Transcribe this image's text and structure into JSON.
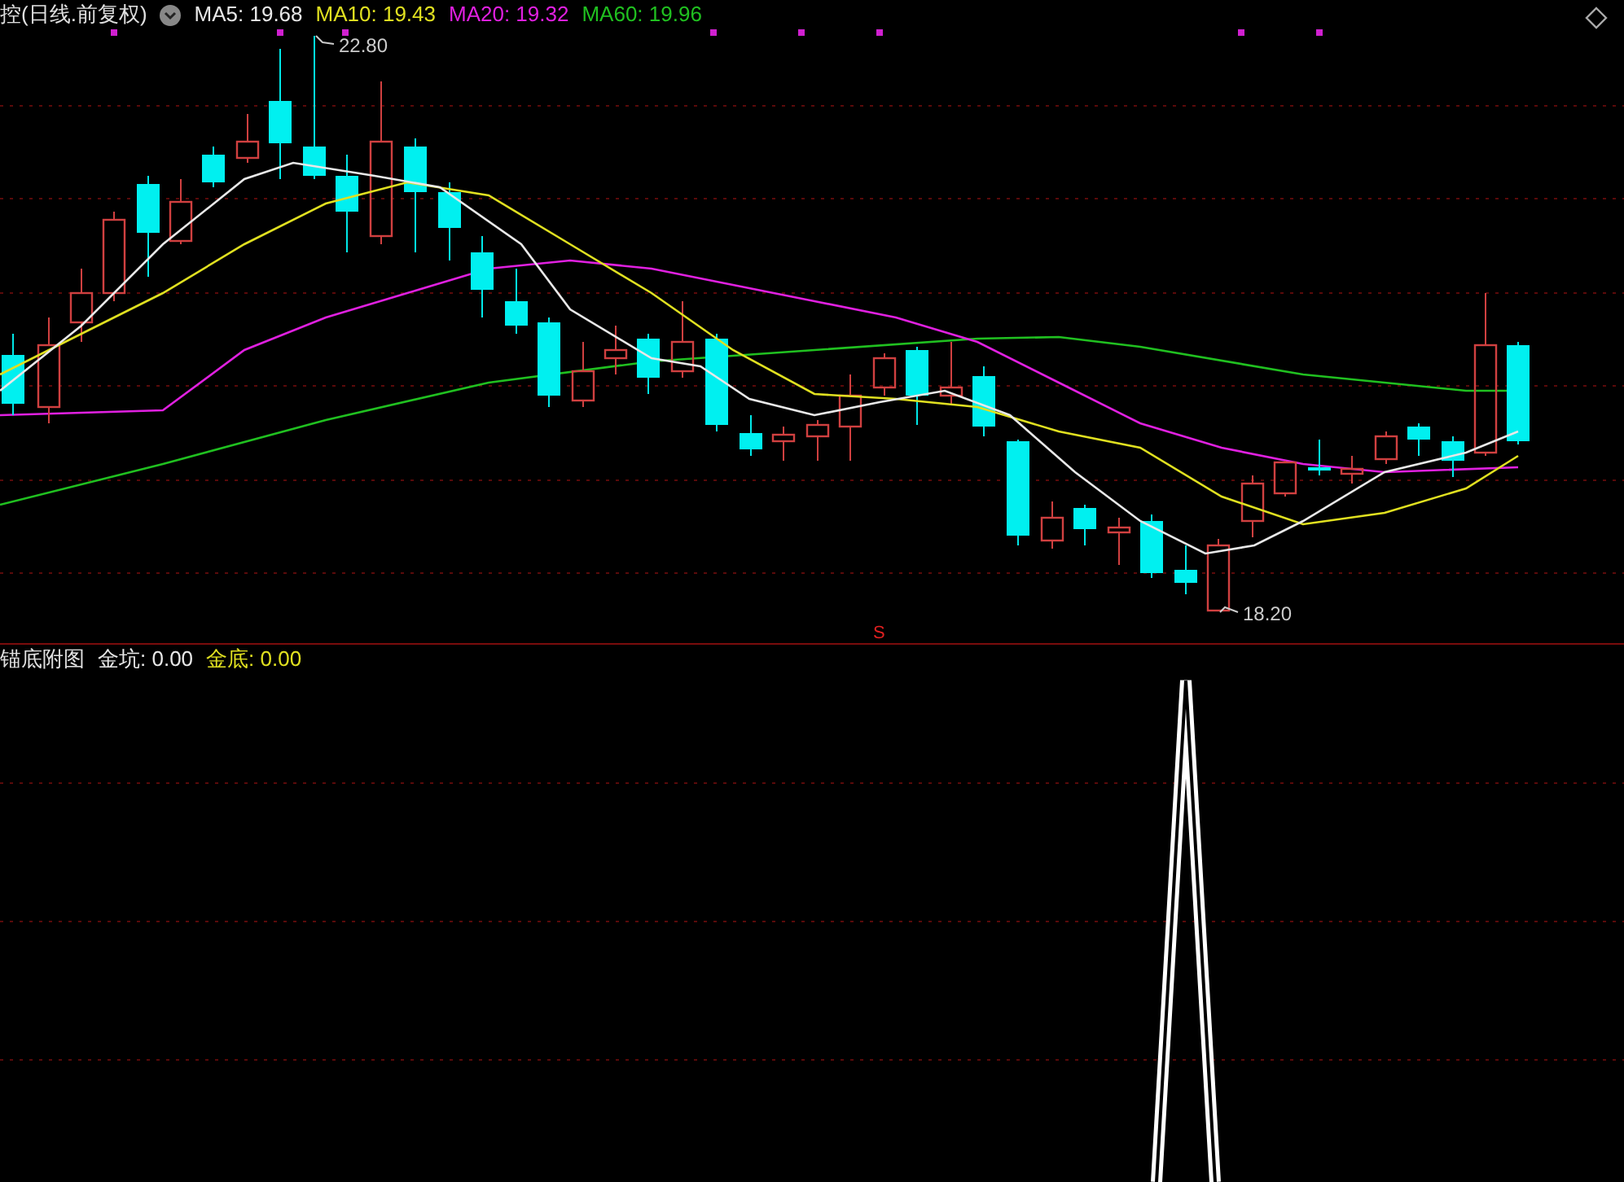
{
  "main_panel": {
    "title": "控(日线.前复权)",
    "legend": [
      {
        "label": "MA5: 19.68",
        "color": "#e8e8e8"
      },
      {
        "label": "MA10: 19.43",
        "color": "#e0e020"
      },
      {
        "label": "MA20: 19.32",
        "color": "#e020e0"
      },
      {
        "label": "MA60: 19.96",
        "color": "#20c020"
      }
    ],
    "high_label": "22.80",
    "low_label": "18.20",
    "signal": "S"
  },
  "indicator_panel": {
    "title": "锚底附图",
    "legend": [
      {
        "label": "金坑: 0.00",
        "color": "#e8e8e8"
      },
      {
        "label": "金底: 0.00",
        "color": "#e0e020"
      }
    ]
  }
}
